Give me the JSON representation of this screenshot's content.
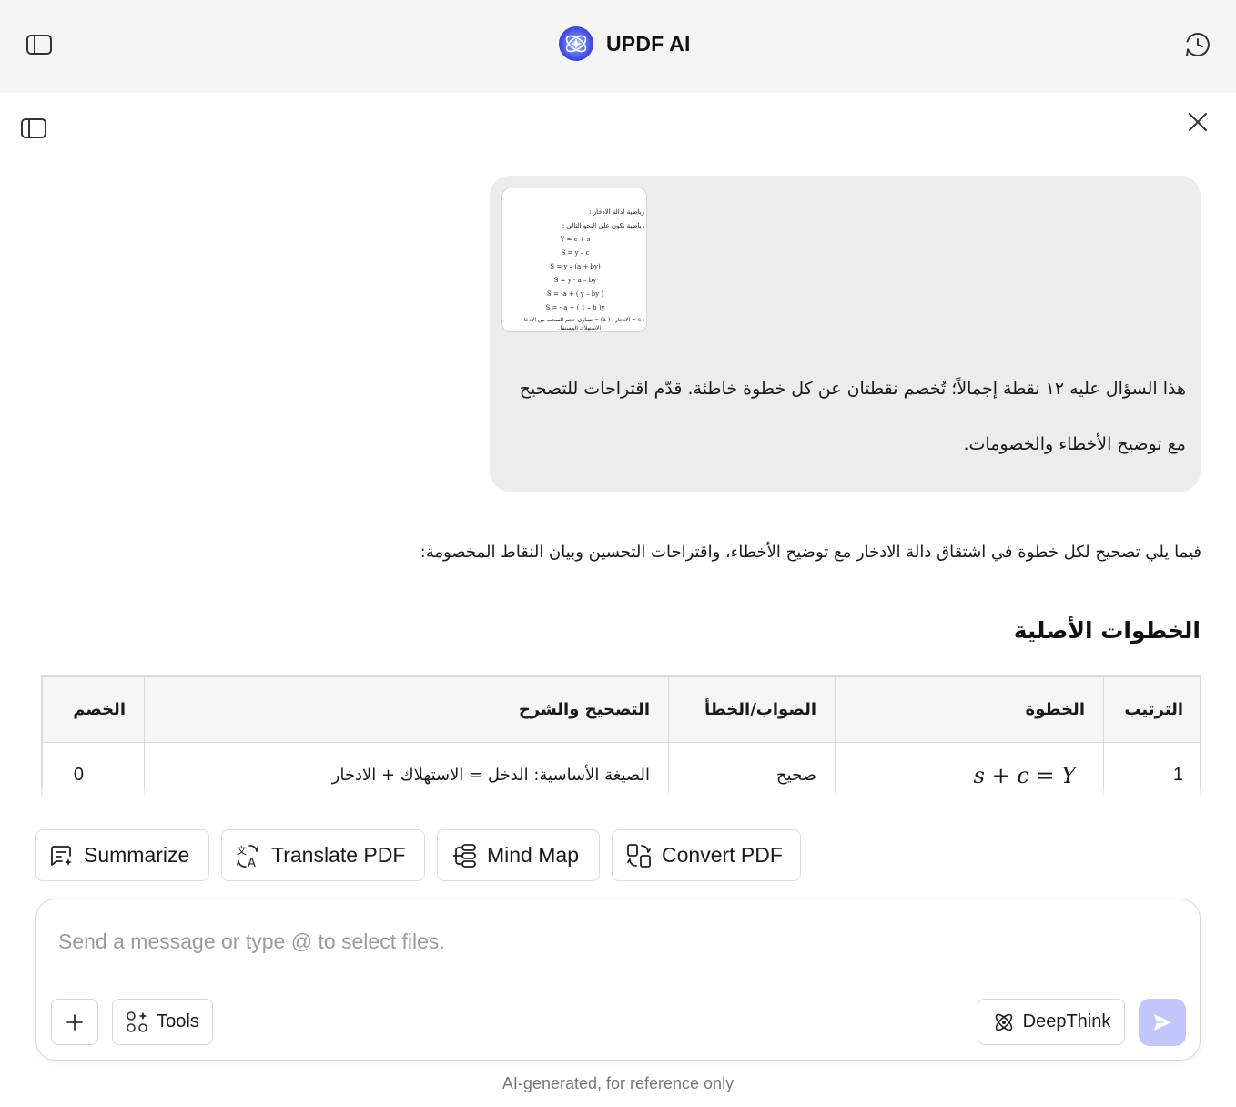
{
  "app": {
    "title": "UPDF AI",
    "accent_color": "#5b6cf0",
    "icons": {
      "sidebar_toggle": "sidebar-panel-icon",
      "history": "clock-history-icon",
      "close": "close-icon",
      "logo": "updf-ai-logo-icon"
    }
  },
  "user_message": {
    "attachment": {
      "lines": [
        "رياضية لدالة الادخار :",
        "رياضية تكون على النحو التالي :",
        "Y = c + s",
        "S = y – c",
        "S = y – (a + by)",
        "S = y - a – by",
        "S = -a + ( y – by )",
        "S = - a + ( 1 – b )y",
        ": s = الادخار ، (-a) = تساوي حجم السحب من الادخا",
        "الاستهلاك المستقل"
      ]
    },
    "text": "هذا السؤال عليه ١٢ نقطة إجمالاً؛ تُخصم نقطتان عن كل خطوة خاطئة. قدّم اقتراحات للتصحيح مع توضيح الأخطاء والخصومات."
  },
  "response": {
    "intro": "فيما يلي تصحيح لكل خطوة في اشتقاق دالة الادخار مع توضيح الأخطاء، واقتراحات التحسين وبيان النقاط المخصومة:",
    "section_heading": "الخطوات الأصلية",
    "table": {
      "headers": [
        "الترتيب",
        "الخطوة",
        "الصواب/الخطأ",
        "التصحيح والشرح",
        "الخصم"
      ],
      "rows": [
        [
          "1",
          "s + c = Y",
          "صحيح",
          "الصيغة الأساسية: الدخل = الاستهلاك + الادخار",
          "0"
        ]
      ]
    }
  },
  "quick_actions": [
    {
      "label": "Summarize",
      "icon": "summarize-icon"
    },
    {
      "label": "Translate PDF",
      "icon": "translate-icon"
    },
    {
      "label": "Mind Map",
      "icon": "mind-map-icon"
    },
    {
      "label": "Convert PDF",
      "icon": "convert-icon"
    }
  ],
  "composer": {
    "placeholder": "Send a message or type @ to select files.",
    "value": "",
    "tools_label": "Tools",
    "deepthink_label": "DeepThink",
    "send_color": "#c3c6fb"
  },
  "footer_note": "AI-generated, for reference only"
}
